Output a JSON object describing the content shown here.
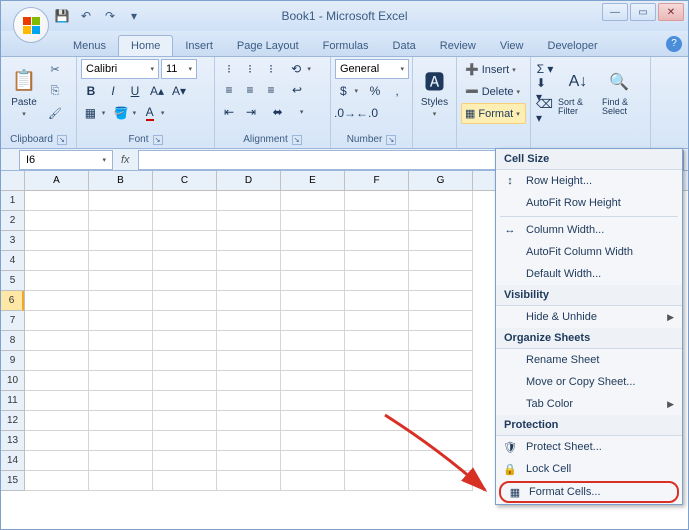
{
  "title": "Book1 - Microsoft Excel",
  "tabs": {
    "menus": "Menus",
    "home": "Home",
    "insert": "Insert",
    "page_layout": "Page Layout",
    "formulas": "Formulas",
    "data": "Data",
    "review": "Review",
    "view": "View",
    "developer": "Developer"
  },
  "ribbon": {
    "clipboard": {
      "label": "Clipboard",
      "paste": "Paste"
    },
    "font": {
      "label": "Font",
      "name": "Calibri",
      "size": "11"
    },
    "alignment": {
      "label": "Alignment"
    },
    "number": {
      "label": "Number",
      "format": "General"
    },
    "styles": {
      "label": "Styles"
    },
    "cells": {
      "insert": "Insert",
      "delete": "Delete",
      "format": "Format"
    },
    "editing": {
      "sort_filter": "Sort & Filter",
      "find_select": "Find & Select"
    }
  },
  "namebox": "I6",
  "columns": [
    "A",
    "B",
    "C",
    "D",
    "E",
    "F",
    "G"
  ],
  "rows": [
    "1",
    "2",
    "3",
    "4",
    "5",
    "6",
    "7",
    "8",
    "9",
    "10",
    "11",
    "12",
    "13",
    "14",
    "15"
  ],
  "selected_row_index": 5,
  "menu": {
    "sec_cellsize": "Cell Size",
    "row_height": "Row Height...",
    "autofit_row": "AutoFit Row Height",
    "col_width": "Column Width...",
    "autofit_col": "AutoFit Column Width",
    "default_width": "Default Width...",
    "sec_visibility": "Visibility",
    "hide_unhide": "Hide & Unhide",
    "sec_organize": "Organize Sheets",
    "rename": "Rename Sheet",
    "move_copy": "Move or Copy Sheet...",
    "tab_color": "Tab Color",
    "sec_protection": "Protection",
    "protect_sheet": "Protect Sheet...",
    "lock_cell": "Lock Cell",
    "format_cells": "Format Cells..."
  }
}
